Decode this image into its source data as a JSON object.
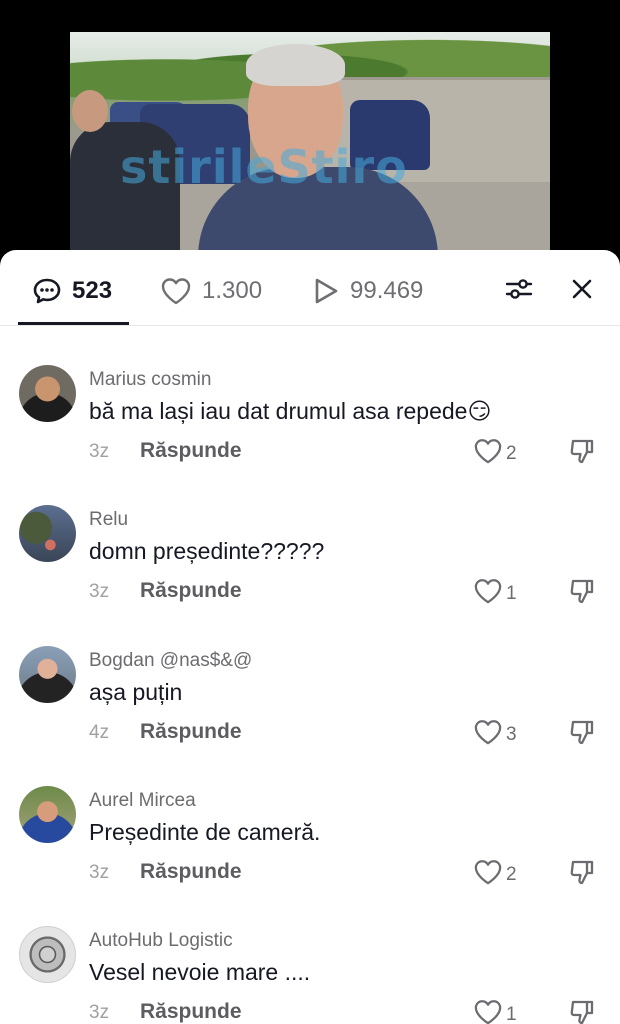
{
  "video": {
    "watermark": "stirileStiro"
  },
  "stats": {
    "comments": "523",
    "likes": "1.300",
    "plays": "99.469",
    "icons": {
      "comments": "comment-bubble-icon",
      "likes": "heart-icon",
      "plays": "play-icon",
      "filter": "sliders-icon",
      "close": "close-icon"
    }
  },
  "reply_label": "Răspunde",
  "comments": [
    {
      "username": "Marius cosmin",
      "text": "bă ma lași iau dat drumul asa repede😏",
      "age": "3z",
      "likes": "2"
    },
    {
      "username": "Relu",
      "text": "domn președinte?????",
      "age": "3z",
      "likes": "1"
    },
    {
      "username": "Bogdan @nas$&@",
      "text": "așa puțin",
      "age": "4z",
      "likes": "3"
    },
    {
      "username": "Aurel Mircea",
      "text": "Președinte de cameră.",
      "age": "3z",
      "likes": "2"
    },
    {
      "username": "AutoHub Logistic",
      "text": "Vesel nevoie mare ....",
      "age": "3z",
      "likes": "1"
    }
  ],
  "colors": {
    "text_primary": "#161823",
    "text_secondary": "#6c6c70",
    "divider": "#e8e8e8"
  }
}
